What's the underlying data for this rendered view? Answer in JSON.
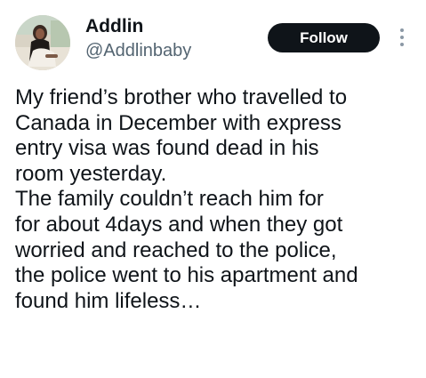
{
  "author": {
    "display_name": "Addlin",
    "handle": "@Addlinbaby",
    "avatar_icon": "profile-photo"
  },
  "actions": {
    "follow_label": "Follow",
    "more_icon": "vertical-ellipsis-icon"
  },
  "tweet": {
    "lines": [
      "My friend’s brother who travelled to",
      "Canada in December with express",
      "entry visa was found dead in his",
      "room yesterday.",
      "The family couldn’t reach him for",
      "for about 4days and when they got",
      "worried and reached to the police,",
      "the police went to his apartment and",
      "found him lifeless…"
    ]
  },
  "colors": {
    "text_primary": "#0f1419",
    "text_secondary": "#536471",
    "follow_button_bg": "#0f1419",
    "follow_button_text": "#ffffff",
    "background": "#ffffff"
  }
}
